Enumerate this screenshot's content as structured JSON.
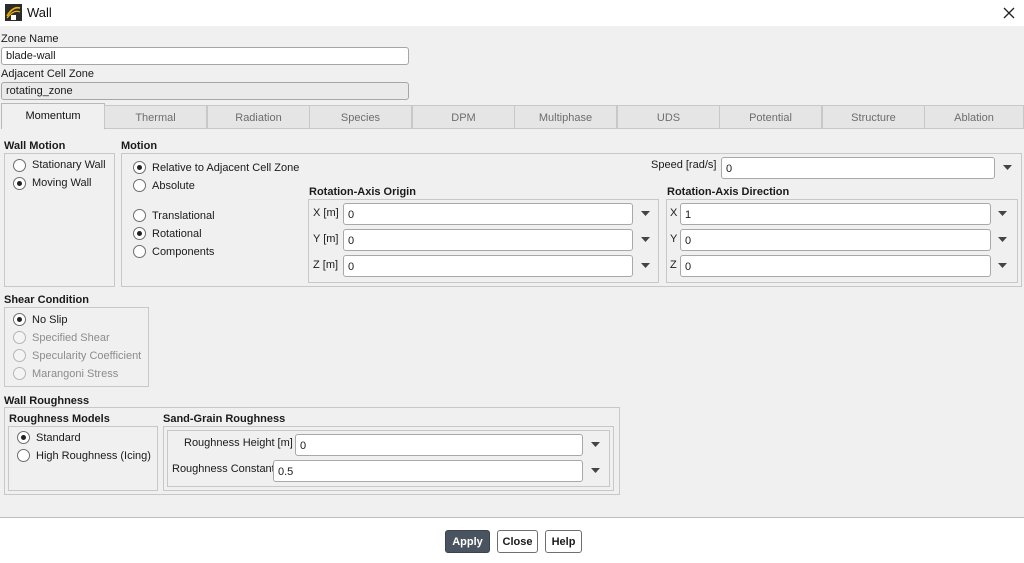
{
  "window": {
    "title": "Wall",
    "app_icon": "fluent-app-icon",
    "close_icon": "close-icon"
  },
  "zone_name": {
    "label": "Zone Name",
    "value": "blade-wall"
  },
  "adjacent_cell_zone": {
    "label": "Adjacent Cell Zone",
    "value": "rotating_zone"
  },
  "tabs": [
    "Momentum",
    "Thermal",
    "Radiation",
    "Species",
    "DPM",
    "Multiphase",
    "UDS",
    "Potential",
    "Structure",
    "Ablation"
  ],
  "active_tab": "Momentum",
  "wall_motion": {
    "title": "Wall Motion",
    "options": [
      "Stationary Wall",
      "Moving Wall"
    ],
    "selected": "Moving Wall"
  },
  "motion": {
    "title": "Motion",
    "reference_options": [
      "Relative to Adjacent Cell Zone",
      "Absolute"
    ],
    "reference_selected": "Relative to Adjacent Cell Zone",
    "type_options": [
      "Translational",
      "Rotational",
      "Components"
    ],
    "type_selected": "Rotational",
    "speed": {
      "label": "Speed [rad/s]",
      "value": "0"
    }
  },
  "rotation_axis_origin": {
    "title": "Rotation-Axis Origin",
    "x": {
      "label": "X [m]",
      "value": "0"
    },
    "y": {
      "label": "Y [m]",
      "value": "0"
    },
    "z": {
      "label": "Z [m]",
      "value": "0"
    }
  },
  "rotation_axis_direction": {
    "title": "Rotation-Axis Direction",
    "x": {
      "label": "X",
      "value": "1"
    },
    "y": {
      "label": "Y",
      "value": "0"
    },
    "z": {
      "label": "Z",
      "value": "0"
    }
  },
  "shear_condition": {
    "title": "Shear Condition",
    "options": [
      "No Slip",
      "Specified Shear",
      "Specularity Coefficient",
      "Marangoni Stress"
    ],
    "selected": "No Slip"
  },
  "wall_roughness": {
    "title": "Wall Roughness",
    "models_title": "Roughness Models",
    "models": [
      "Standard",
      "High Roughness (Icing)"
    ],
    "model_selected": "Standard",
    "sand_grain_title": "Sand-Grain Roughness",
    "height": {
      "label": "Roughness Height [m]",
      "value": "0"
    },
    "constant": {
      "label": "Roughness Constant",
      "value": "0.5"
    }
  },
  "buttons": {
    "apply": "Apply",
    "close": "Close",
    "help": "Help"
  },
  "colors": {
    "primary_button": "#4a5461",
    "background": "#f0f0f0"
  }
}
